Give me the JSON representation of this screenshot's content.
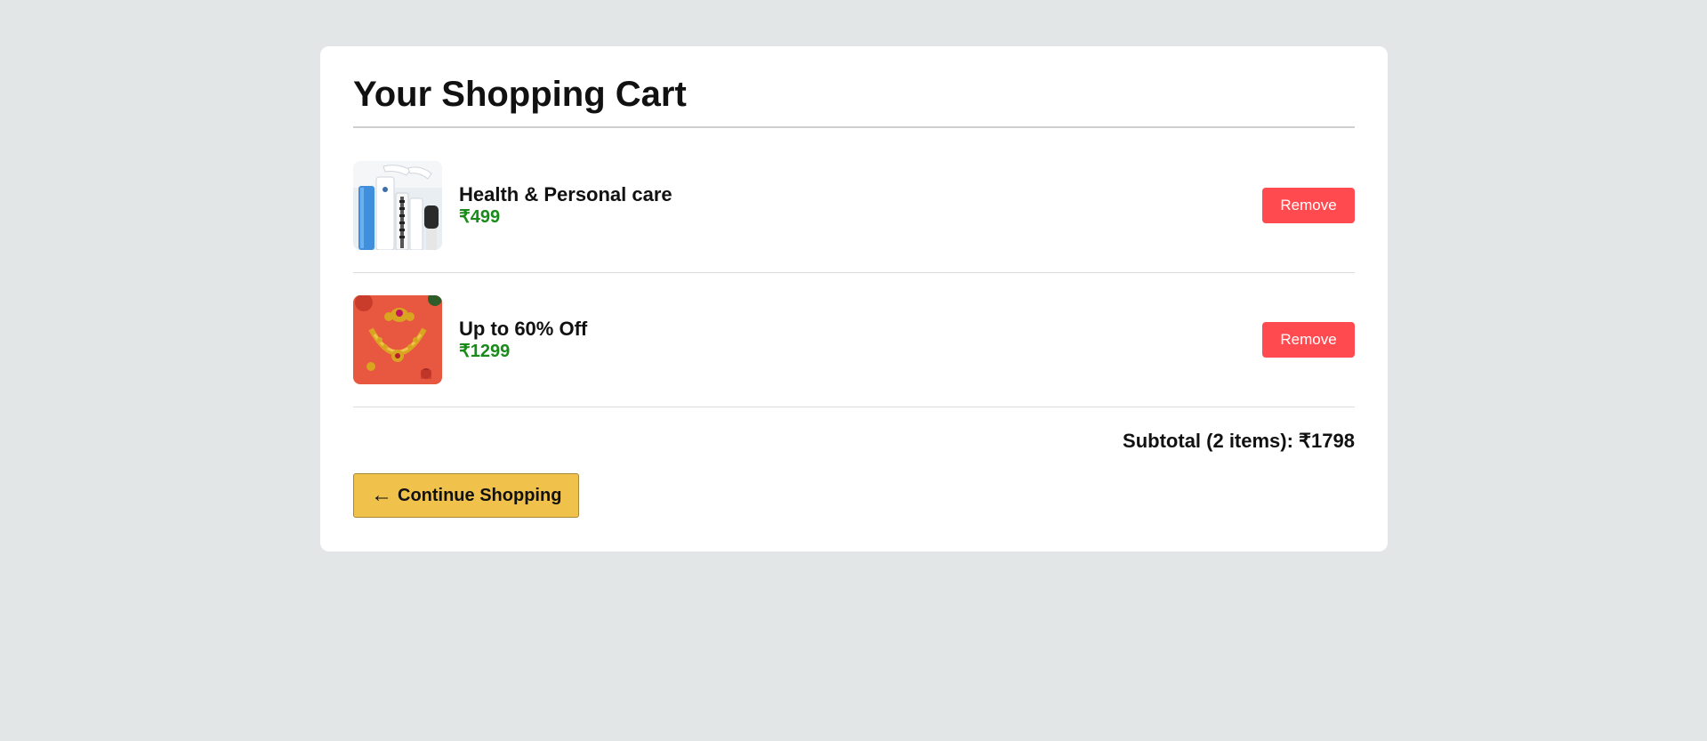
{
  "cart": {
    "title": "Your Shopping Cart",
    "items": [
      {
        "name": "Health & Personal care",
        "price": "₹499",
        "remove_label": "Remove",
        "thumb_icon": "personal-care-products-image"
      },
      {
        "name": "Up to 60% Off",
        "price": "₹1299",
        "remove_label": "Remove",
        "thumb_icon": "jewelry-set-image"
      }
    ],
    "subtotal": "Subtotal (2 items): ₹1798",
    "continue_label": "Continue Shopping",
    "continue_arrow": "←"
  },
  "colors": {
    "page_background": "#e3e6e6",
    "price": "#1a8a1a",
    "remove_button": "#ff4a4f",
    "continue_button": "#f0c14b"
  }
}
